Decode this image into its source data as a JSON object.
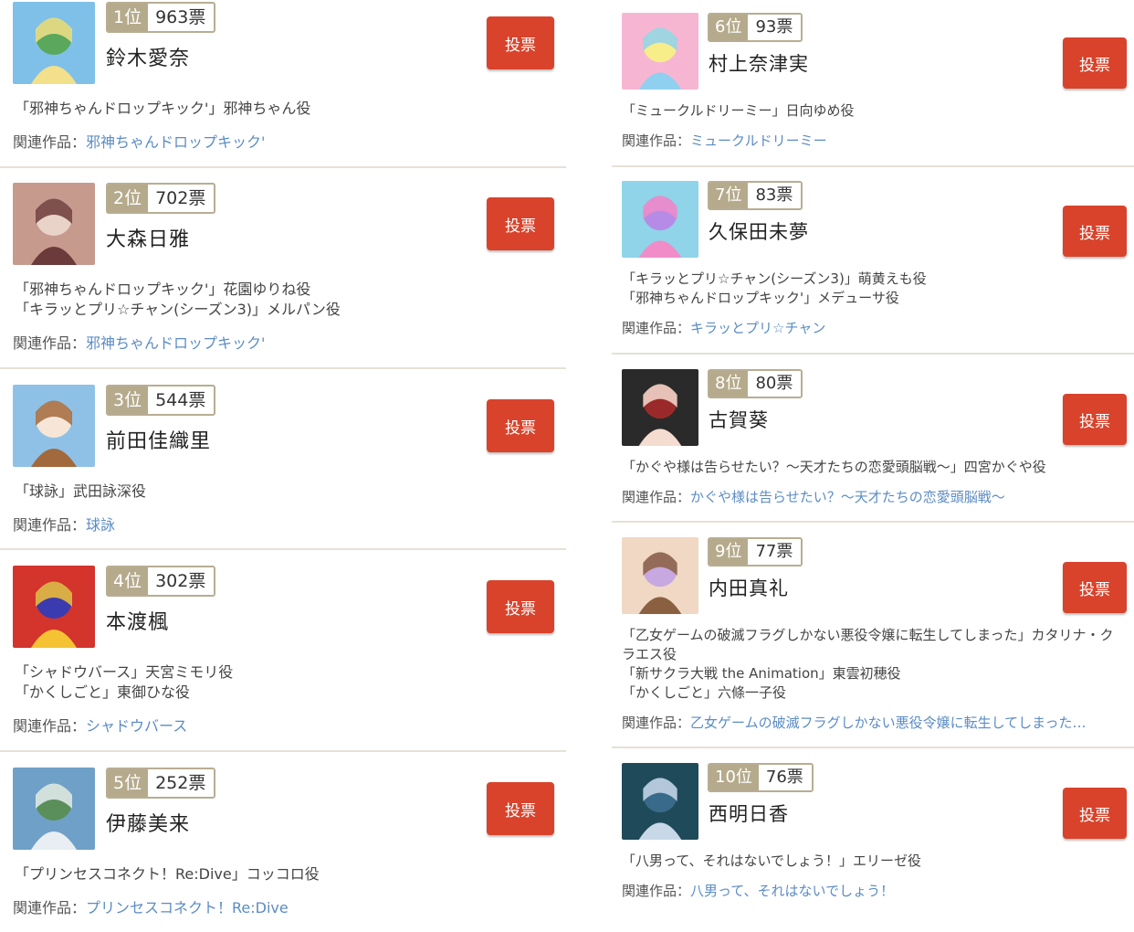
{
  "vote_label": "投票",
  "related_label": "関連作品：",
  "left": [
    {
      "rank": "1位",
      "votes": "963票",
      "name": "鈴木愛奈",
      "roles": [
        "「邪神ちゃんドロップキック'」邪神ちゃん役"
      ],
      "related": "邪神ちゃんドロップキック'"
    },
    {
      "rank": "2位",
      "votes": "702票",
      "name": "大森日雅",
      "roles": [
        "「邪神ちゃんドロップキック'」花園ゆりね役",
        "「キラッとプリ☆チャン(シーズン3)」メルパン役"
      ],
      "related": "邪神ちゃんドロップキック'"
    },
    {
      "rank": "3位",
      "votes": "544票",
      "name": "前田佳織里",
      "roles": [
        "「球詠」武田詠深役"
      ],
      "related": "球詠"
    },
    {
      "rank": "4位",
      "votes": "302票",
      "name": "本渡楓",
      "roles": [
        "「シャドウバース」天宮ミモリ役",
        "「かくしごと」東御ひな役"
      ],
      "related": "シャドウバース"
    },
    {
      "rank": "5位",
      "votes": "252票",
      "name": "伊藤美来",
      "roles": [
        "「プリンセスコネクト！Re:Dive」コッコロ役"
      ],
      "related": "プリンセスコネクト！Re:Dive"
    }
  ],
  "right": [
    {
      "rank": "6位",
      "votes": "93票",
      "name": "村上奈津実",
      "roles": [
        "「ミュークルドリーミー」日向ゆめ役"
      ],
      "related": "ミュークルドリーミー"
    },
    {
      "rank": "7位",
      "votes": "83票",
      "name": "久保田未夢",
      "roles": [
        "「キラッとプリ☆チャン(シーズン3)」萌黄えも役",
        "「邪神ちゃんドロップキック'」メデューサ役"
      ],
      "related": "キラッとプリ☆チャン"
    },
    {
      "rank": "8位",
      "votes": "80票",
      "name": "古賀葵",
      "roles": [
        "「かぐや様は告らせたい？～天才たちの恋愛頭脳戦～」四宮かぐや役"
      ],
      "related": "かぐや様は告らせたい？～天才たちの恋愛頭脳戦～"
    },
    {
      "rank": "9位",
      "votes": "77票",
      "name": "内田真礼",
      "roles": [
        "「乙女ゲームの破滅フラグしかない悪役令嬢に転生してしまった」カタリナ・ク",
        "ラエス役",
        "「新サクラ大戦 the Animation」東雲初穂役",
        "「かくしごと」六條一子役"
      ],
      "related": "乙女ゲームの破滅フラグしかない悪役令嬢に転生してしまった…"
    },
    {
      "rank": "10位",
      "votes": "76票",
      "name": "西明日香",
      "roles": [
        "「八男って、それはないでしょう！」エリーゼ役"
      ],
      "related": "八男って、それはないでしょう！"
    }
  ]
}
